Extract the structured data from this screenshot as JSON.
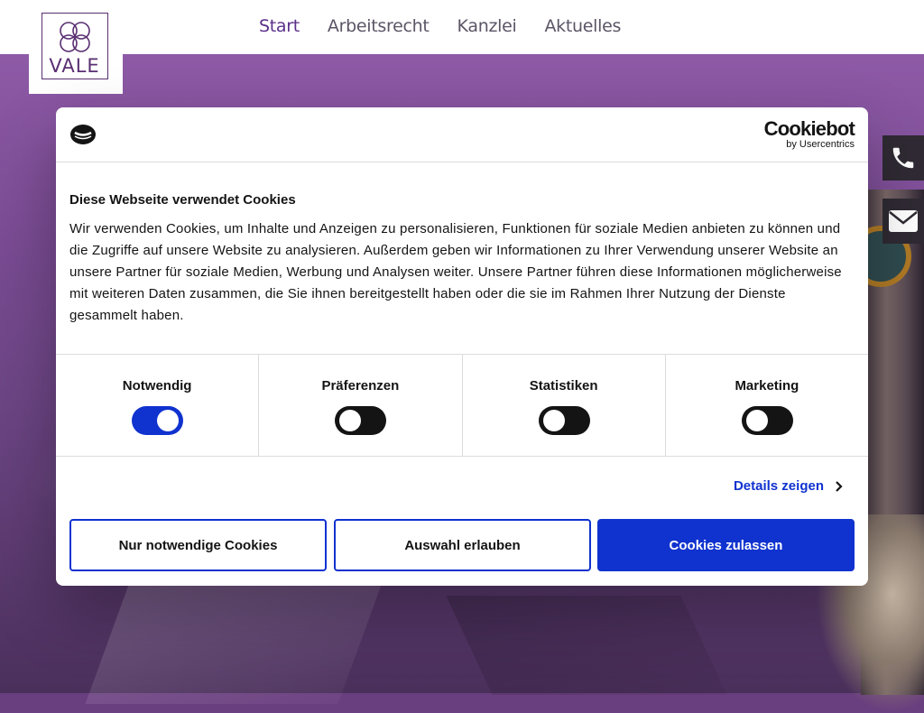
{
  "header": {
    "logo_text": "VALE",
    "nav": [
      "Start",
      "Arbeitsrecht",
      "Kanzlei",
      "Aktuelles"
    ],
    "active_nav": "Start"
  },
  "side_contacts": [
    "phone-icon",
    "envelope-icon"
  ],
  "cookie_dialog": {
    "brand": "Cookiebot",
    "brand_sub": "by Usercentrics",
    "title": "Diese Webseite verwendet Cookies",
    "text": "Wir verwenden Cookies, um Inhalte und Anzeigen zu personalisieren, Funktionen für soziale Medien anbieten zu können und die Zugriffe auf unsere Website zu analysieren. Außerdem geben wir Informationen zu Ihrer Verwendung unserer Website an unsere Partner für soziale Medien, Werbung und Analysen weiter. Unsere Partner führen diese Informationen möglicherweise mit weiteren Daten zusammen, die Sie ihnen bereitgestellt haben oder die sie im Rahmen Ihrer Nutzung der Dienste gesammelt haben.",
    "categories": [
      {
        "label": "Notwendig",
        "enabled": true
      },
      {
        "label": "Präferenzen",
        "enabled": false
      },
      {
        "label": "Statistiken",
        "enabled": false
      },
      {
        "label": "Marketing",
        "enabled": false
      }
    ],
    "details_link": "Details zeigen",
    "buttons": {
      "necessary_only": "Nur notwendige Cookies",
      "allow_selection": "Auswahl erlauben",
      "allow_all": "Cookies zulassen"
    }
  },
  "colors": {
    "accent": "#1032cf",
    "brand_purple": "#5a2f72",
    "hero_purple": "#7a4b93"
  }
}
